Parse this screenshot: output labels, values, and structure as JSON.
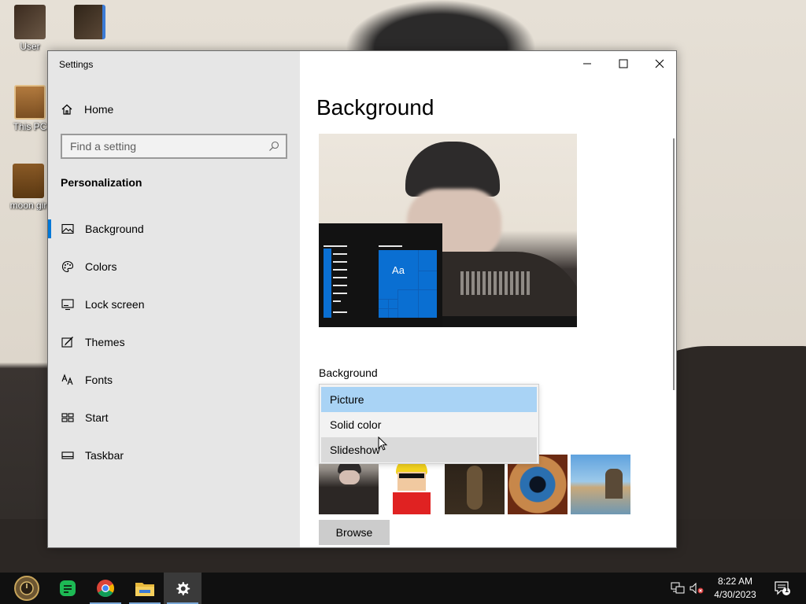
{
  "desktop": {
    "icons": [
      {
        "label": "User"
      },
      {
        "label": ""
      },
      {
        "label": "This PC"
      },
      {
        "label": "moon gir"
      }
    ]
  },
  "window": {
    "title": "Settings",
    "controls": {
      "minimize": "minimize-icon",
      "maximize": "maximize-icon",
      "close": "close-icon"
    }
  },
  "nav": {
    "home_label": "Home",
    "search_placeholder": "Find a setting",
    "section_title": "Personalization",
    "items": [
      {
        "label": "Background",
        "icon": "picture-icon",
        "active": true
      },
      {
        "label": "Colors",
        "icon": "palette-icon",
        "active": false
      },
      {
        "label": "Lock screen",
        "icon": "lock-screen-icon",
        "active": false
      },
      {
        "label": "Themes",
        "icon": "themes-icon",
        "active": false
      },
      {
        "label": "Fonts",
        "icon": "fonts-icon",
        "active": false
      },
      {
        "label": "Start",
        "icon": "start-icon",
        "active": false
      },
      {
        "label": "Taskbar",
        "icon": "taskbar-icon",
        "active": false
      }
    ]
  },
  "main": {
    "page_title": "Background",
    "preview_tile_text": "Aa",
    "background_label": "Background",
    "dropdown_options": [
      {
        "label": "Picture",
        "state": "selected"
      },
      {
        "label": "Solid color",
        "state": "normal"
      },
      {
        "label": "Slideshow",
        "state": "hover"
      }
    ],
    "browse_label": "Browse"
  },
  "taskbar": {
    "apps": [
      "steampunk-clock-icon",
      "notes-icon",
      "chrome-icon",
      "file-explorer-icon",
      "settings-icon"
    ],
    "clock_time": "8:22 AM",
    "clock_date": "4/30/2023",
    "notification_count": "1"
  },
  "colors": {
    "accent": "#0078d7",
    "selection": "#a9d3f5",
    "taskbar": "#101010"
  }
}
